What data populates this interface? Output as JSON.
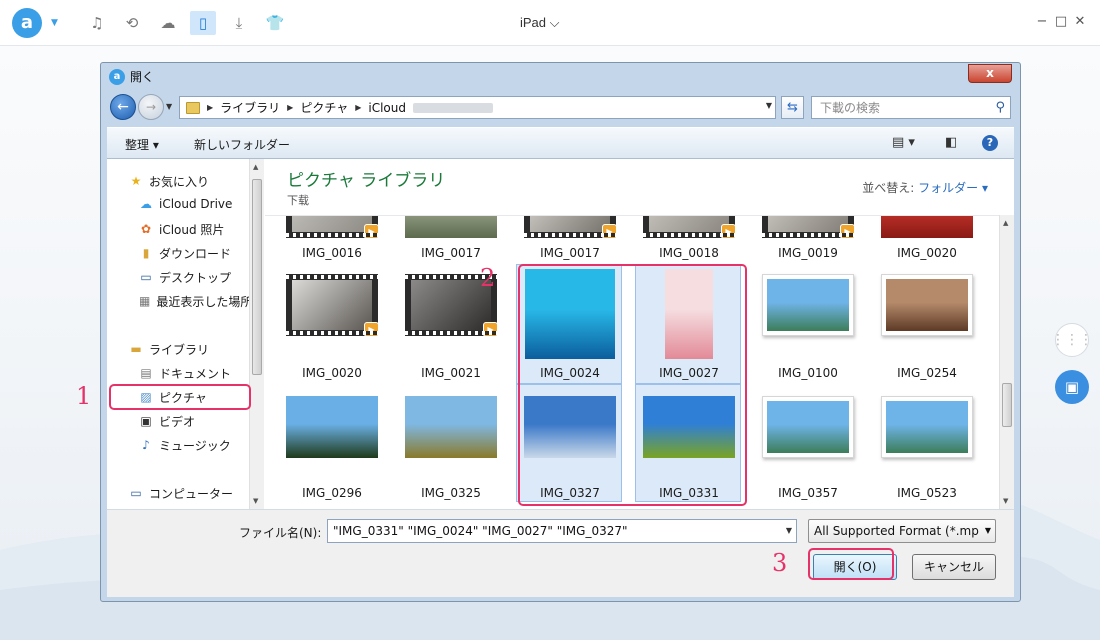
{
  "app": {
    "device": "iPad",
    "device_chevron": "⌵",
    "logo_letter": "a",
    "toolbar": [
      {
        "name": "music-icon",
        "glyph": "♫"
      },
      {
        "name": "history-icon",
        "glyph": "⟲"
      },
      {
        "name": "cloud-icon",
        "glyph": "☁"
      },
      {
        "name": "ipad-icon",
        "glyph": "▯"
      },
      {
        "name": "download-icon",
        "glyph": "⤓"
      },
      {
        "name": "tshirt-icon",
        "glyph": "👕"
      }
    ],
    "window_controls": [
      "−",
      "□",
      "✕"
    ]
  },
  "dialog": {
    "title": "開く",
    "close": "x",
    "breadcrumb": [
      "ライブラリ",
      "ピクチャ",
      "iCloud"
    ],
    "search_placeholder": "下載の検索",
    "commands": {
      "organize": "整理 ▾",
      "new_folder": "新しいフォルダー",
      "help": "?"
    },
    "nav": {
      "favorites": "お気に入り",
      "favorites_items": [
        "iCloud Drive",
        "iCloud 照片",
        "ダウンロード",
        "デスクトップ",
        "最近表示した場所"
      ],
      "libraries": "ライブラリ",
      "library_items": [
        "ドキュメント",
        "ピクチャ",
        "ビデオ",
        "ミュージック"
      ],
      "computer": "コンピューター"
    },
    "library_title": "ピクチャ ライブラリ",
    "library_subtitle": "下载",
    "sort_label": "並べ替え:",
    "sort_value": "フォルダー ▾",
    "files": [
      {
        "label": "IMG_0016",
        "kind": "video",
        "colors": [
          "#c9c7c2",
          "#8d8a84"
        ]
      },
      {
        "label": "IMG_0017",
        "kind": "photo",
        "colors": [
          "#9aa58d",
          "#5d6a4d"
        ]
      },
      {
        "label": "IMG_0017",
        "kind": "video",
        "colors": [
          "#d9d6d1",
          "#75716b"
        ]
      },
      {
        "label": "IMG_0018",
        "kind": "video",
        "colors": [
          "#cfccc6",
          "#8a867f"
        ]
      },
      {
        "label": "IMG_0019",
        "kind": "video",
        "colors": [
          "#d3d0c9",
          "#827e77"
        ]
      },
      {
        "label": "IMG_0020",
        "kind": "photo",
        "colors": [
          "#c5352d",
          "#8a1a14"
        ]
      },
      {
        "label": "IMG_0020",
        "kind": "video",
        "colors": [
          "#dcdad6",
          "#5a5753"
        ]
      },
      {
        "label": "IMG_0021",
        "kind": "video",
        "colors": [
          "#8c8a88",
          "#2d2c2b"
        ]
      },
      {
        "label": "IMG_0024",
        "kind": "photo",
        "colors": [
          "#28b8e8",
          "#0b5e9c"
        ]
      },
      {
        "label": "IMG_0027",
        "kind": "photo",
        "colors": [
          "#f5dde0",
          "#e28a97"
        ]
      },
      {
        "label": "IMG_0100",
        "kind": "photo",
        "colors": [
          "#6fb4e8",
          "#3c7d5a"
        ]
      },
      {
        "label": "IMG_0254",
        "kind": "photo",
        "colors": [
          "#b58a6b",
          "#5d3a26"
        ]
      },
      {
        "label": "IMG_0296",
        "kind": "photo",
        "colors": [
          "#6ab0e6",
          "#1f3a1a"
        ]
      },
      {
        "label": "IMG_0325",
        "kind": "photo",
        "colors": [
          "#7fb8e3",
          "#8a7a2a"
        ]
      },
      {
        "label": "IMG_0327",
        "kind": "photo",
        "colors": [
          "#3a78c8",
          "#c9d8e8"
        ]
      },
      {
        "label": "IMG_0331",
        "kind": "photo",
        "colors": [
          "#2f7fd6",
          "#7aa422"
        ]
      },
      {
        "label": "IMG_0357",
        "kind": "photo",
        "colors": [
          "#6fb4e8",
          "#3c7d5a"
        ]
      },
      {
        "label": "IMG_0523",
        "kind": "photo",
        "colors": [
          "#6fb4e8",
          "#3c7d5a"
        ]
      }
    ],
    "selected": [
      "IMG_0024",
      "IMG_0027",
      "IMG_0327",
      "IMG_0331"
    ],
    "filename_label": "ファイル名(N):",
    "filename_value": "\"IMG_0331\" \"IMG_0024\" \"IMG_0027\" \"IMG_0327\"",
    "format": "All Supported Format (*.mp",
    "open_button": "開く(O)",
    "cancel_button": "キャンセル"
  },
  "annotations": {
    "step1": "1",
    "step2": "2",
    "step3": "3",
    "color": "#e5336a"
  },
  "side_buttons": [
    {
      "name": "grid-icon"
    },
    {
      "name": "toolbox-icon"
    }
  ],
  "colors": {
    "accent": "#3a9fe6",
    "library_title": "#1b7a3a"
  }
}
